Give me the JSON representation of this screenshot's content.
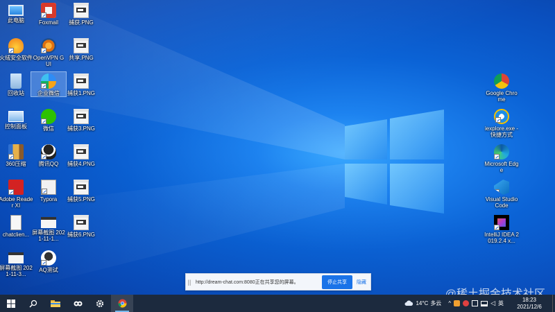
{
  "desktop": {
    "left_icons": [
      {
        "label": "此电脑",
        "icon": "computer-icon"
      },
      {
        "label": "Foxmail",
        "icon": "foxmail-icon"
      },
      {
        "label": "捕获.PNG",
        "icon": "png-file-icon"
      },
      {
        "label": "火绒安全软件",
        "icon": "huorong-icon"
      },
      {
        "label": "OpenVPN GUI",
        "icon": "openvpn-icon"
      },
      {
        "label": "共享.PNG",
        "icon": "png-file-icon"
      },
      {
        "label": "回收站",
        "icon": "recycle-bin-icon"
      },
      {
        "label": "企业微信",
        "icon": "wecom-icon"
      },
      {
        "label": "捕获1.PNG",
        "icon": "png-file-icon"
      },
      {
        "label": "控制面板",
        "icon": "control-panel-icon"
      },
      {
        "label": "微信",
        "icon": "wechat-icon"
      },
      {
        "label": "捕获3.PNG",
        "icon": "png-file-icon"
      },
      {
        "label": "360压缩",
        "icon": "archive-icon"
      },
      {
        "label": "腾讯QQ",
        "icon": "qq-icon"
      },
      {
        "label": "捕获4.PNG",
        "icon": "png-file-icon"
      },
      {
        "label": "Adobe Reader XI",
        "icon": "adobe-reader-icon"
      },
      {
        "label": "Typora",
        "icon": "typora-icon"
      },
      {
        "label": "捕获5.PNG",
        "icon": "png-file-icon"
      },
      {
        "label": "chatclien...",
        "icon": "folder-icon"
      },
      {
        "label": "屏幕截图 2021-11-1...",
        "icon": "screenshot-icon"
      },
      {
        "label": "捕获6.PNG",
        "icon": "png-file-icon"
      },
      {
        "label": "屏幕截图 2021-11-3...",
        "icon": "screenshot-icon"
      },
      {
        "label": "AQ测试",
        "icon": "aq-icon"
      }
    ],
    "right_icons": [
      {
        "label": "Google Chrome",
        "icon": "chrome-icon"
      },
      {
        "label": "iexplore.exe - 快捷方式",
        "icon": "ie-icon"
      },
      {
        "label": "Microsoft Edge",
        "icon": "edge-icon"
      },
      {
        "label": "Visual Studio Code",
        "icon": "vscode-icon"
      },
      {
        "label": "IntelliJ IDEA 2019.2.4 x...",
        "icon": "intellij-icon"
      }
    ]
  },
  "share_bar": {
    "grip": "||",
    "message": "http://dream-chat.com:8080正在共享您的屏幕。",
    "stop_label": "停止共享",
    "hide_label": "隐藏"
  },
  "watermark": "@稀土掘金技术社区",
  "taskbar": {
    "buttons": [
      "start-icon",
      "search-icon",
      "file-explorer-icon",
      "app-icon",
      "settings-icon",
      "chrome-icon"
    ],
    "weather_temp": "14°C",
    "weather_text": "多云",
    "ime": "英",
    "time": "18:23",
    "date": "2021/12/6"
  },
  "colors": {
    "wallpaper": "#0b63d6",
    "taskbar": "#1c2a3e",
    "accent": "#1a73e8"
  }
}
